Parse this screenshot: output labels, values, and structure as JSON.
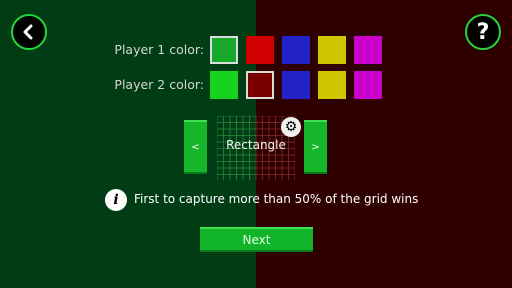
{
  "header": {
    "back_icon": "chevron-left-icon",
    "help_icon": "question-mark-icon",
    "help_glyph": "?"
  },
  "player1": {
    "label": "Player 1 color:",
    "selected_index": 0,
    "colors": [
      "#15a82a",
      "#d10000",
      "#2323c8",
      "#cfc800",
      "#cc00cc"
    ]
  },
  "player2": {
    "label": "Player 2 color:",
    "selected_index": 1,
    "colors": [
      "#14d41d",
      "#7a0000",
      "#2323c8",
      "#cfc800",
      "#cc00cc"
    ]
  },
  "shape_selector": {
    "prev_glyph": "<",
    "next_glyph": ">",
    "shape_label": "Rectangle",
    "settings_icon": "gear-icon",
    "settings_glyph": "⚙"
  },
  "info": {
    "icon_glyph": "i",
    "text": "First to capture more than 50% of the grid wins"
  },
  "footer": {
    "next_label": "Next"
  },
  "colors": {
    "left_bg": "#003d14",
    "right_bg": "#2e0000",
    "accent": "#27d63a",
    "button_green": "#12b52a"
  }
}
